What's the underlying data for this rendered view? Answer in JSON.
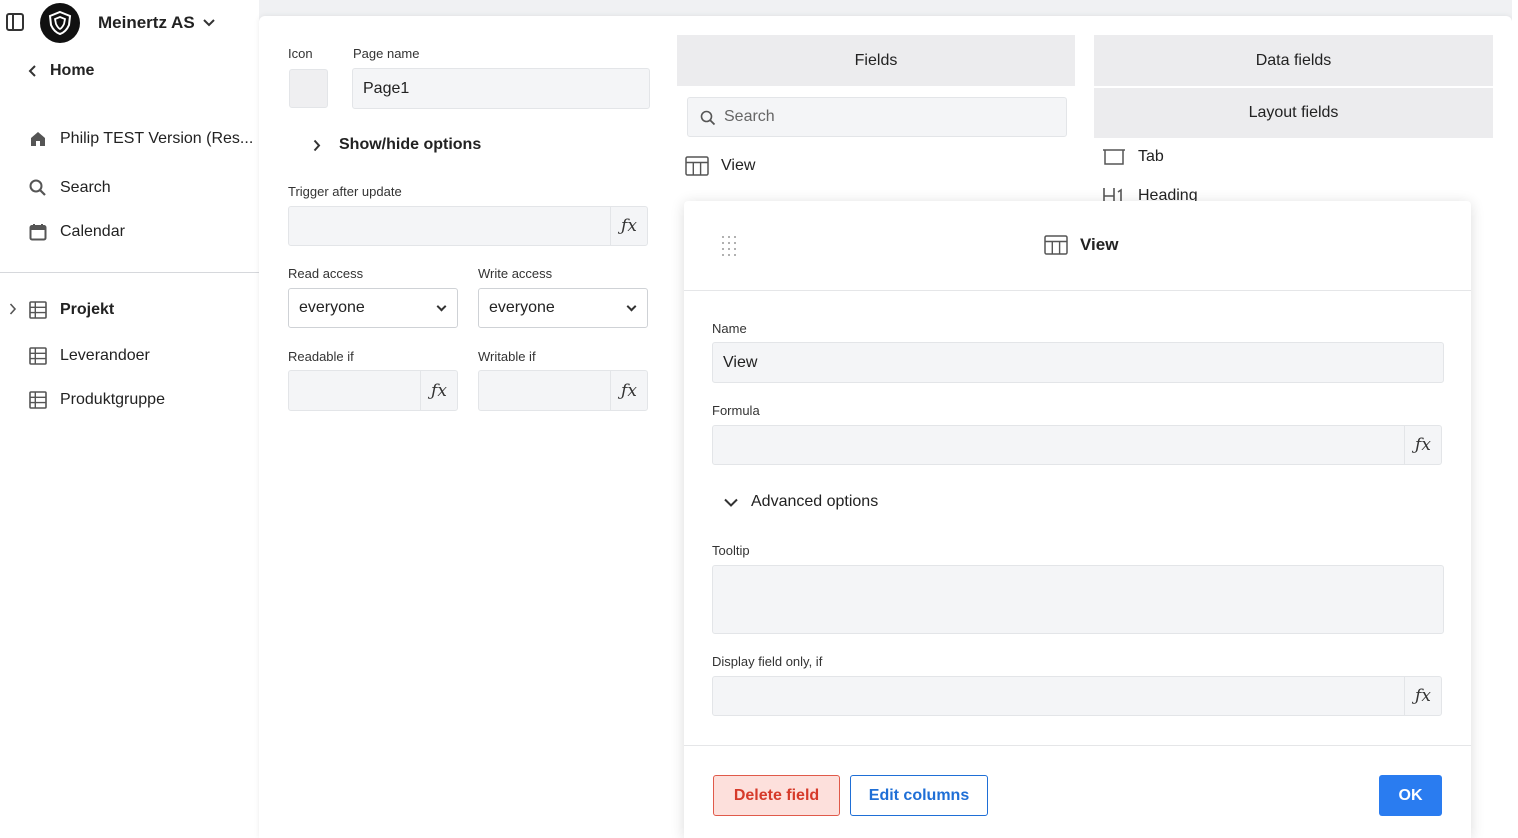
{
  "sidebar": {
    "org_name": "Meinertz AS",
    "home_label": "Home",
    "items": [
      {
        "label": "Philip TEST Version (Res...",
        "icon": "home-icon"
      },
      {
        "label": "Search",
        "icon": "search-icon"
      },
      {
        "label": "Calendar",
        "icon": "calendar-icon"
      }
    ],
    "tables": [
      {
        "label": "Projekt",
        "icon": "table-icon"
      },
      {
        "label": "Leverandoer",
        "icon": "table-icon"
      },
      {
        "label": "Produktgruppe",
        "icon": "table-icon"
      }
    ]
  },
  "page_settings": {
    "icon_label": "Icon",
    "page_name_label": "Page name",
    "page_name_value": "Page1",
    "show_hide_label": "Show/hide options",
    "trigger_label": "Trigger after update",
    "read_access_label": "Read access",
    "read_access_value": "everyone",
    "write_access_label": "Write access",
    "write_access_value": "everyone",
    "readable_if_label": "Readable if",
    "writable_if_label": "Writable if",
    "fx_symbol": "ƒx"
  },
  "fields_panel": {
    "title": "Fields",
    "search_placeholder": "Search",
    "items": [
      {
        "label": "View"
      }
    ]
  },
  "data_fields_panel": {
    "title": "Data fields",
    "layout_title": "Layout fields",
    "items": [
      {
        "label": "Tab"
      },
      {
        "label": "Heading"
      }
    ]
  },
  "modal": {
    "title": "View",
    "name_label": "Name",
    "name_value": "View",
    "formula_label": "Formula",
    "advanced_label": "Advanced options",
    "tooltip_label": "Tooltip",
    "display_if_label": "Display field only, if",
    "delete_label": "Delete field",
    "edit_columns_label": "Edit columns",
    "ok_label": "OK"
  },
  "colors": {
    "primary": "#2a7cf0",
    "danger": "#d63a2a",
    "danger_bg": "#fde0dc"
  }
}
